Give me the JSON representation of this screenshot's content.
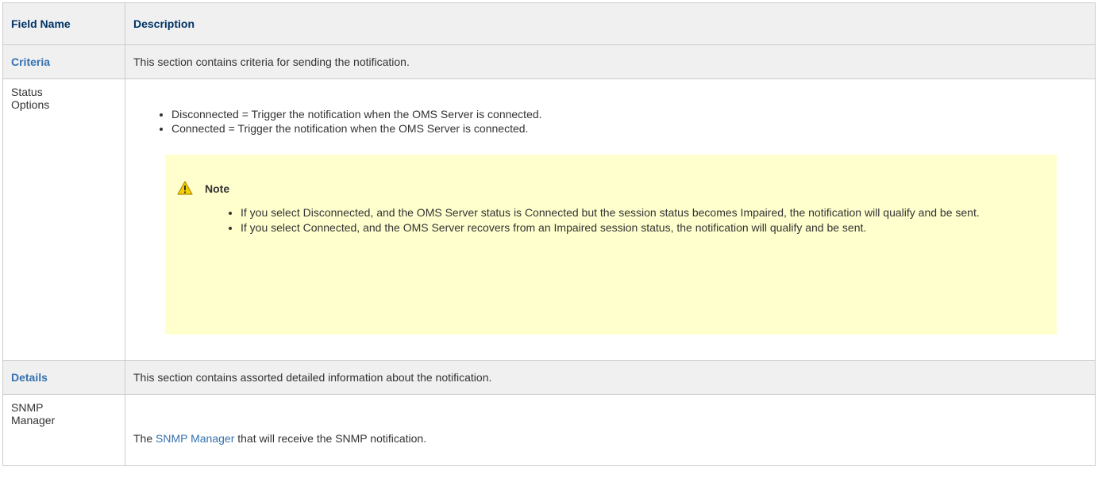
{
  "header": {
    "field_name": "Field Name",
    "description": "Description"
  },
  "criteria": {
    "name": "Criteria",
    "description": "This section contains criteria for sending the notification."
  },
  "status_options": {
    "name_line1": "Status",
    "name_line2": "Options",
    "options": [
      "Disconnected = Trigger the notification when the OMS Server is connected.",
      "Connected = Trigger the notification when the OMS Server is connected."
    ],
    "note": {
      "icon": "warning-icon",
      "title": "Note",
      "items": [
        "If you select Disconnected, and the OMS Server status is Connected but the session status becomes Impaired, the notification will qualify and be sent.",
        "If you select Connected, and the OMS Server recovers from an Impaired session status, the notification will qualify and be sent."
      ]
    }
  },
  "details": {
    "name": "Details",
    "description": "This section contains assorted detailed information about the notification."
  },
  "snmp_manager": {
    "name_line1": "SNMP",
    "name_line2": "Manager",
    "desc_prefix": "The",
    "link_text": "SNMP Manager",
    "desc_suffix": "that will receive the SNMP notification."
  },
  "colors": {
    "header_text": "#003366",
    "link": "#3572b0",
    "note_bg": "#ffffce",
    "header_bg": "#f0f0f0"
  }
}
